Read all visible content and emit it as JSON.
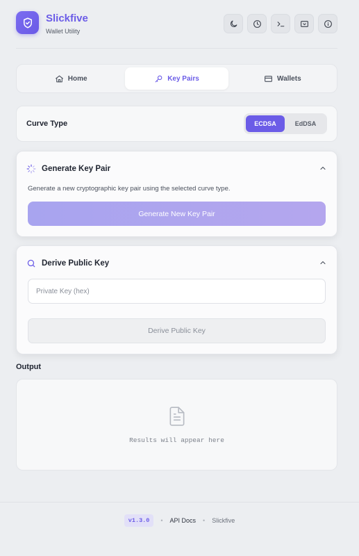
{
  "header": {
    "title": "Slickfive",
    "subtitle": "Wallet Utility",
    "buttons": [
      {
        "name": "theme-toggle-button",
        "icon": "moon-icon"
      },
      {
        "name": "history-button",
        "icon": "clock-icon"
      },
      {
        "name": "terminal-button",
        "icon": "terminal-icon"
      },
      {
        "name": "screen-button",
        "icon": "screen-icon"
      },
      {
        "name": "info-button",
        "icon": "info-icon"
      }
    ]
  },
  "tabs": [
    {
      "label": "Home",
      "icon": "home-icon",
      "active": false
    },
    {
      "label": "Key Pairs",
      "icon": "key-icon",
      "active": true
    },
    {
      "label": "Wallets",
      "icon": "card-icon",
      "active": false
    }
  ],
  "curve": {
    "label": "Curve Type",
    "options": [
      "ECDSA",
      "EdDSA"
    ],
    "selected": "ECDSA"
  },
  "generate": {
    "title": "Generate Key Pair",
    "description": "Generate a new cryptographic key pair using the selected curve type.",
    "button": "Generate New Key Pair"
  },
  "derive": {
    "title": "Derive Public Key",
    "input_placeholder": "Private Key (hex)",
    "input_value": "",
    "button": "Derive Public Key"
  },
  "output": {
    "label": "Output",
    "placeholder": "Results will appear here"
  },
  "footer": {
    "version": "v1.3.0",
    "api_docs": "API Docs",
    "brand": "Slickfive"
  },
  "colors": {
    "accent": "#6b5ce7",
    "background": "#eceef1"
  }
}
